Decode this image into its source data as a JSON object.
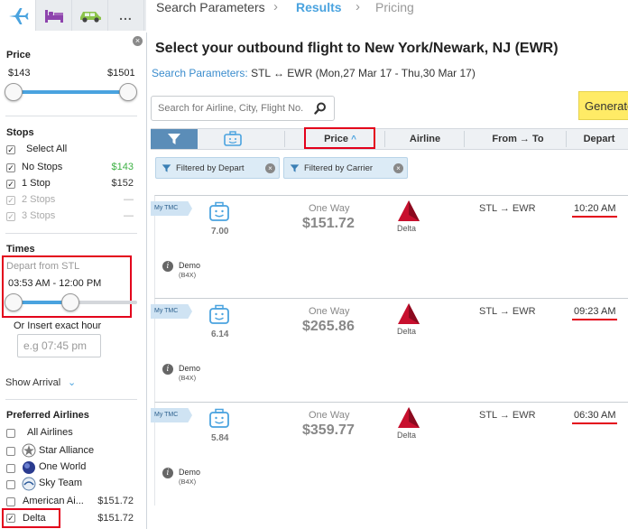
{
  "nav": {
    "icons": [
      "airplane-icon",
      "bed-icon",
      "car-icon",
      "more-icon"
    ],
    "more_label": "...",
    "steps": [
      "Search Parameters",
      "Results",
      "Pricing"
    ],
    "active_step": "Results"
  },
  "sidebar": {
    "price": {
      "title": "Price",
      "min": "$143",
      "max": "$1501"
    },
    "stops": {
      "title": "Stops",
      "select_all": "Select All",
      "items": [
        {
          "label": "No Stops",
          "price": "$143",
          "checked": true,
          "disabled": false
        },
        {
          "label": "1 Stop",
          "price": "$152",
          "checked": true,
          "disabled": false
        },
        {
          "label": "2 Stops",
          "price": "—",
          "checked": true,
          "disabled": true
        },
        {
          "label": "3 Stops",
          "price": "—",
          "checked": true,
          "disabled": true
        }
      ]
    },
    "times": {
      "title": "Times",
      "depart_label": "Depart from STL",
      "depart_range": "03:53 AM - 12:00 PM",
      "exact_label": "Or Insert exact hour",
      "exact_placeholder": "e.g 07:45 pm",
      "show_arrival": "Show Arrival"
    },
    "airlines": {
      "title": "Preferred Airlines",
      "items": [
        {
          "label": "All Airlines",
          "price": "",
          "checked": false
        },
        {
          "label": "Star Alliance",
          "price": "",
          "checked": false
        },
        {
          "label": "One World",
          "price": "",
          "checked": false
        },
        {
          "label": "Sky Team",
          "price": "",
          "checked": false
        },
        {
          "label": "American Ai...",
          "price": "$151.72",
          "checked": false
        },
        {
          "label": "Delta",
          "price": "$151.72",
          "checked": true
        }
      ]
    }
  },
  "main": {
    "title": "Select your outbound flight to New York/Newark, NJ (EWR)",
    "search_params_label": "Search Parameters:",
    "search_params_value": "STL ↔ EWR (Mon,27 Mar 17 - Thu,30 Mar 17)",
    "search_placeholder": "Search for Airline, City, Flight No.",
    "generate_label": "Generate",
    "columns": {
      "price": "Price",
      "airline": "Airline",
      "from_to": "From → To",
      "depart": "Depart"
    },
    "chips": [
      "Filtered by Depart",
      "Filtered by Carrier"
    ],
    "flights": [
      {
        "tag": "My TMC",
        "score": "7.00",
        "type": "One Way",
        "price": "$151.72",
        "airline": "Delta",
        "route": "STL → EWR",
        "depart": "10:20 AM",
        "agent": "Demo",
        "agent_code": "(B4X)"
      },
      {
        "tag": "My TMC",
        "score": "6.14",
        "type": "One Way",
        "price": "$265.86",
        "airline": "Delta",
        "route": "STL → EWR",
        "depart": "09:23 AM",
        "agent": "Demo",
        "agent_code": "(B4X)"
      },
      {
        "tag": "My TMC",
        "score": "5.84",
        "type": "One Way",
        "price": "$359.77",
        "airline": "Delta",
        "route": "STL → EWR",
        "depart": "06:30 AM",
        "agent": "Demo",
        "agent_code": "(B4X)"
      }
    ]
  },
  "colors": {
    "accent": "#4aa3df",
    "highlight": "#e3001b",
    "generate": "#ffeb66",
    "delta_red": "#c8102e"
  }
}
